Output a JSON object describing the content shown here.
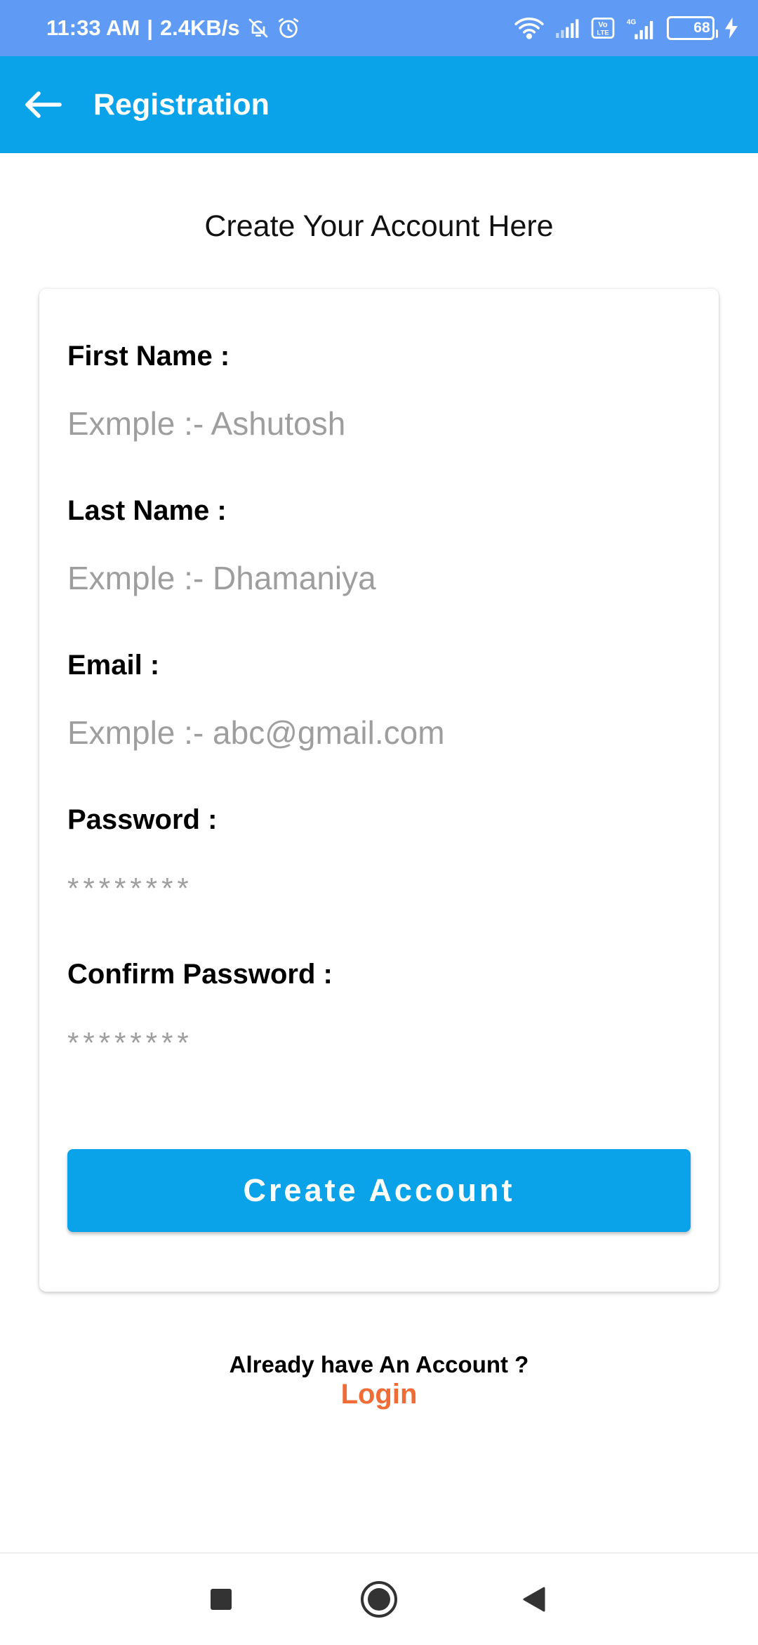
{
  "status_bar": {
    "time": "11:33 AM",
    "separator": "|",
    "network_speed": "2.4KB/s",
    "battery_level": "68",
    "icons": [
      "notifications-off-icon",
      "alarm-icon",
      "wifi-icon",
      "signal-icon",
      "volte-icon",
      "4g-signal-icon",
      "battery-icon",
      "charging-icon"
    ]
  },
  "app_bar": {
    "back_icon": "arrow-left-icon",
    "title": "Registration"
  },
  "form": {
    "heading": "Create Your Account Here",
    "first_name": {
      "label": "First Name :",
      "placeholder": "Exmple :- Ashutosh",
      "value": ""
    },
    "last_name": {
      "label": "Last Name :",
      "placeholder": "Exmple :- Dhamaniya",
      "value": ""
    },
    "email": {
      "label": "Email :",
      "placeholder": "Exmple :- abc@gmail.com",
      "value": ""
    },
    "password": {
      "label": "Password :",
      "placeholder": "********",
      "value": ""
    },
    "confirm_password": {
      "label": "Confirm Password :",
      "placeholder": "********",
      "value": ""
    },
    "submit_label": "Create Account"
  },
  "footer": {
    "already_text": "Already have An Account ?",
    "login_label": "Login"
  },
  "nav_bar": {
    "buttons": [
      "recents-icon",
      "home-icon",
      "back-icon"
    ]
  },
  "colors": {
    "status_bar": "#5f9bf5",
    "app_bar": "#0aa3ea",
    "button": "#0aa3ea",
    "login_link": "#f06b35",
    "placeholder": "#9e9e9e"
  }
}
